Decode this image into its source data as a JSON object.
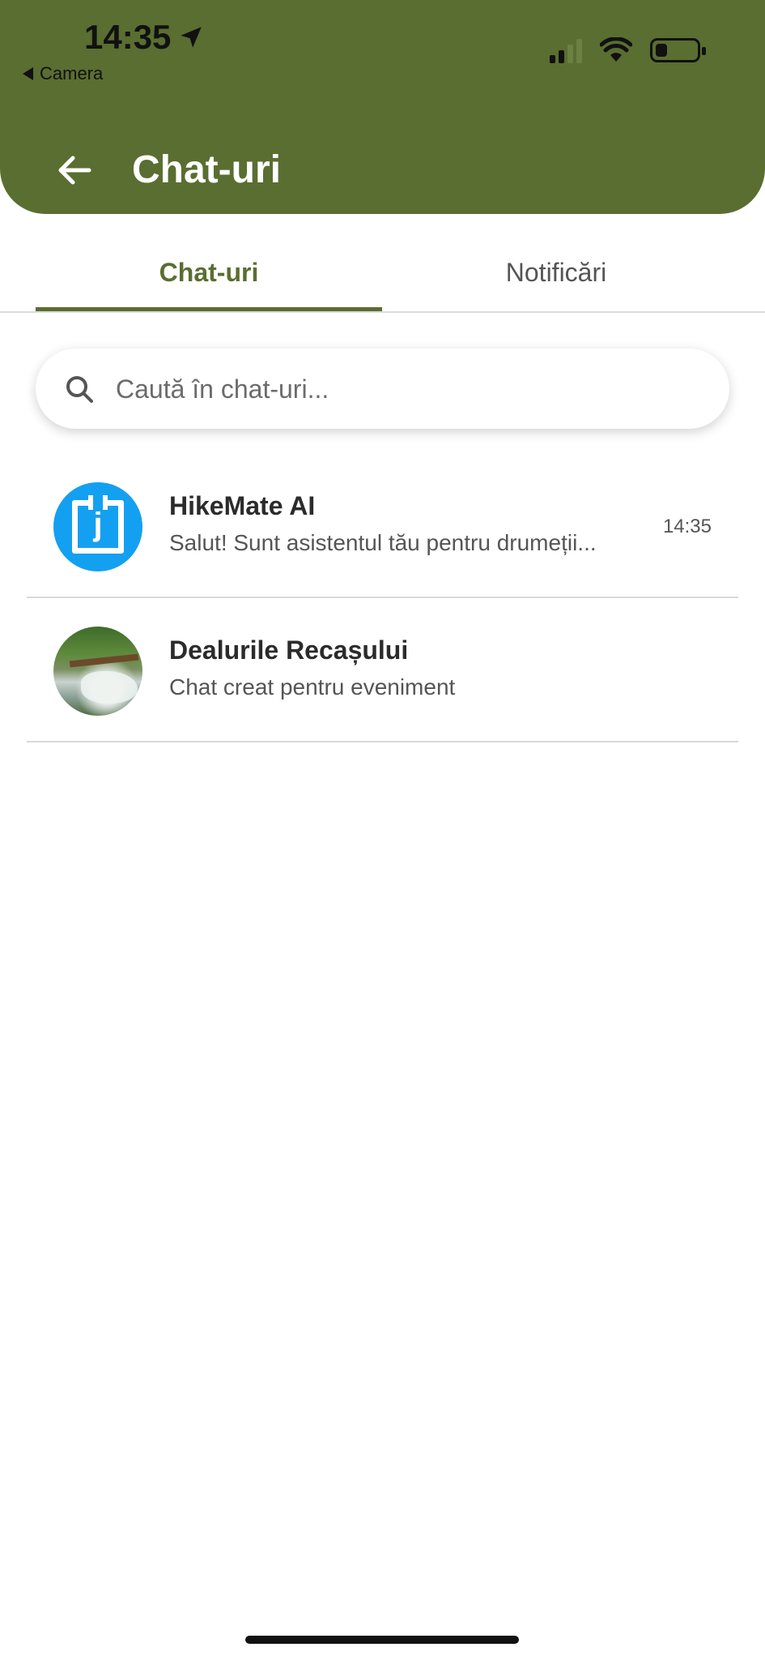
{
  "status_bar": {
    "time": "14:35",
    "back_app_label": "Camera",
    "icons": [
      "location-arrow-icon",
      "cellular-signal-icon",
      "wifi-icon",
      "battery-icon"
    ]
  },
  "header": {
    "title": "Chat-uri",
    "back_icon": "arrow-left-icon",
    "background_color": "#5a6e31"
  },
  "tabs": [
    {
      "label": "Chat-uri",
      "active": true
    },
    {
      "label": "Notificări",
      "active": false
    }
  ],
  "search": {
    "placeholder": "Caută în chat-uri...",
    "value": "",
    "icon": "search-icon"
  },
  "chats": [
    {
      "name": "HikeMate AI",
      "preview": "Salut! Sunt asistentul tău pentru drumeții...",
      "time": "14:35",
      "avatar": "ai-logo-avatar",
      "avatar_letter": "j",
      "avatar_color": "#14a0f0"
    },
    {
      "name": "Dealurile Recașului",
      "preview": "Chat creat pentru eveniment",
      "time": "",
      "avatar": "waterfall-photo-avatar"
    }
  ],
  "colors": {
    "accent": "#5a6e31",
    "divider": "#d9d9d9"
  }
}
